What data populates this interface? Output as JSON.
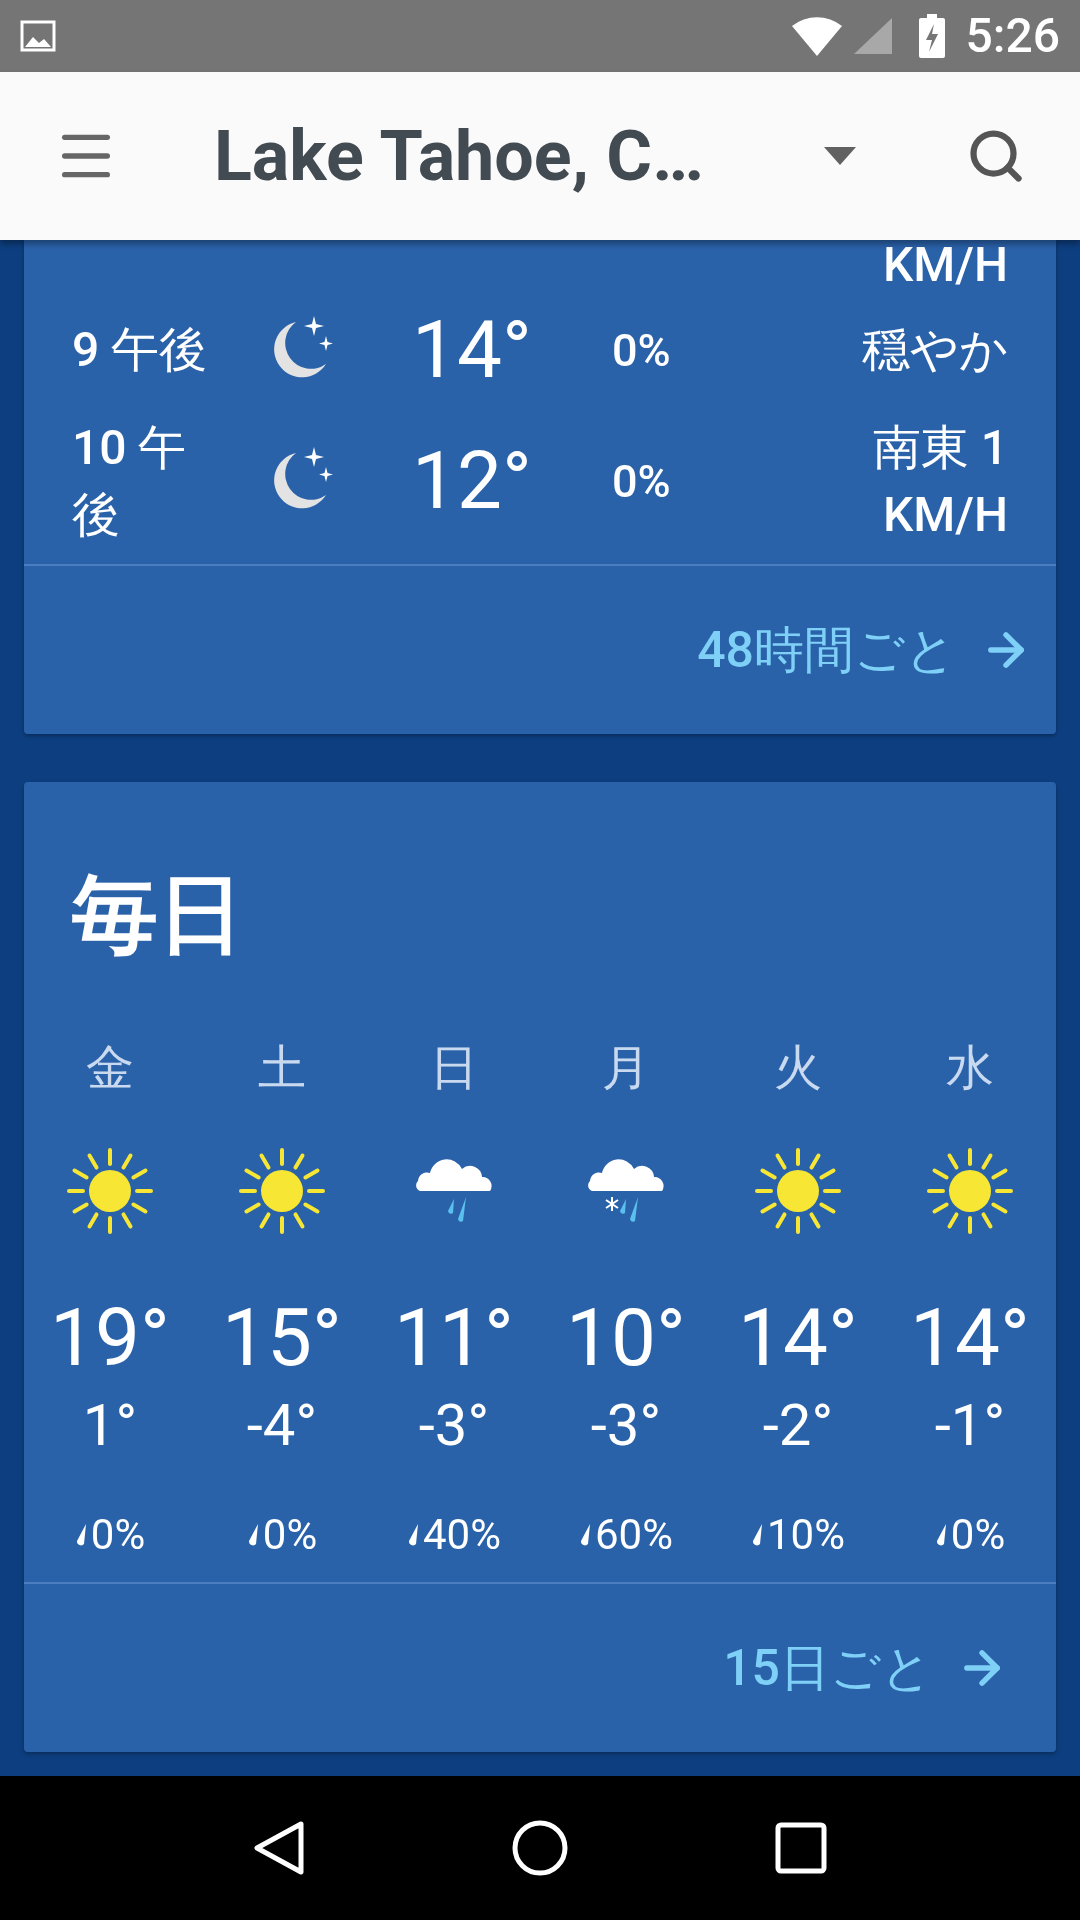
{
  "status_bar": {
    "time": "5:26"
  },
  "app_bar": {
    "title": "Lake Tahoe, C…"
  },
  "hourly": {
    "rows": [
      {
        "kind": "partial",
        "wind": "KM/H"
      },
      {
        "kind": "moon",
        "time": "9 午後",
        "temp": "14°",
        "precip": "0%",
        "wind": "穏やか"
      },
      {
        "kind": "moon",
        "time": "10 午後",
        "temp": "12°",
        "precip": "0%",
        "wind": "南東 1 KM/H"
      }
    ],
    "link": "48時間ごと"
  },
  "daily": {
    "title": "毎日",
    "days": [
      {
        "kind": "sun",
        "day": "金",
        "high": "19°",
        "low": "1°",
        "precip": "0%"
      },
      {
        "kind": "sun",
        "day": "土",
        "high": "15°",
        "low": "-4°",
        "precip": "0%"
      },
      {
        "kind": "rain",
        "day": "日",
        "high": "11°",
        "low": "-3°",
        "precip": "40%"
      },
      {
        "kind": "snow_rain",
        "day": "月",
        "high": "10°",
        "low": "-3°",
        "precip": "60%"
      },
      {
        "kind": "sun",
        "day": "火",
        "high": "14°",
        "low": "-2°",
        "precip": "10%"
      },
      {
        "kind": "sun",
        "day": "水",
        "high": "14°",
        "low": "-1°",
        "precip": "0%"
      }
    ],
    "link": "15日ごと"
  }
}
